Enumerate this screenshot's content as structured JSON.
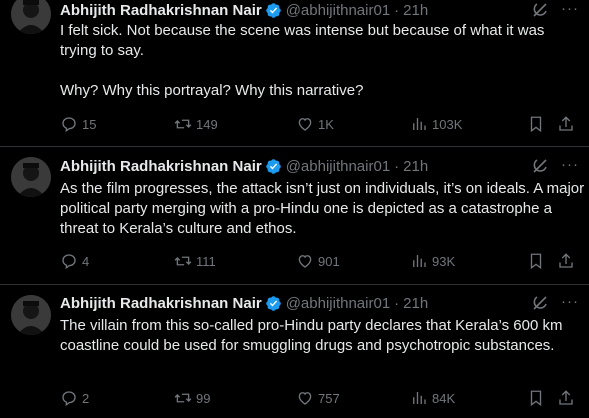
{
  "colors": {
    "background": "#000000",
    "text": "#e7e9ea",
    "muted": "#71767b",
    "verified_badge": "#1d9bf0",
    "divider": "#2f3336"
  },
  "tweets": [
    {
      "author": "Abhijith Radhakrishnan Nair",
      "handle": "@abhijithnair01",
      "separator": "·",
      "time": "21h",
      "more": "···",
      "text": [
        "I felt sick. Not because the scene was intense but because of what it was trying to say.",
        "Why? Why this portrayal? Why this narrative?"
      ],
      "replies": "15",
      "reposts": "149",
      "likes": "1K",
      "views": "103K"
    },
    {
      "author": "Abhijith Radhakrishnan Nair",
      "handle": "@abhijithnair01",
      "separator": "·",
      "time": "21h",
      "more": "···",
      "text": [
        "As the film progresses, the attack isn’t just on individuals, it’s on ideals. A major political party merging with a pro-Hindu one is depicted as a catastrophe a threat to Kerala’s culture and ethos."
      ],
      "replies": "4",
      "reposts": "111",
      "likes": "901",
      "views": "93K"
    },
    {
      "author": "Abhijith Radhakrishnan Nair",
      "handle": "@abhijithnair01",
      "separator": "·",
      "time": "21h",
      "more": "···",
      "text": [
        "The villain from this so-called pro-Hindu party declares that Kerala’s 600 km coastline could be used for smuggling drugs and psychotropic substances."
      ],
      "replies": "2",
      "reposts": "99",
      "likes": "757",
      "views": "84K"
    }
  ],
  "icons": [
    "avatar",
    "verified-badge-icon",
    "grok-icon",
    "more-icon",
    "reply-icon",
    "repost-icon",
    "like-icon",
    "views-icon",
    "bookmark-icon",
    "share-icon"
  ]
}
